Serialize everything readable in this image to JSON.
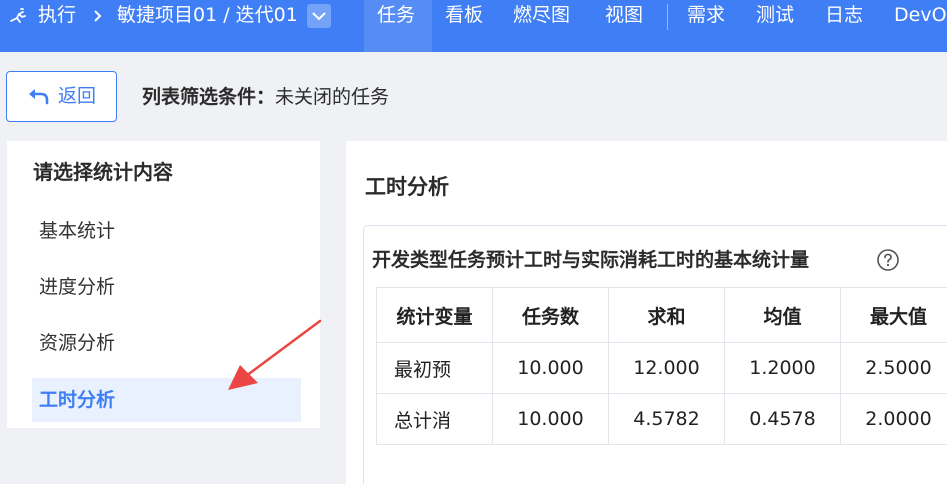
{
  "topbar": {
    "breadcrumb_root": "执行",
    "breadcrumb_path": "敏捷项目01 / 迭代01",
    "nav": [
      {
        "label": "任务",
        "active": true
      },
      {
        "label": "看板"
      },
      {
        "label": "燃尽图"
      },
      {
        "label": "视图"
      },
      {
        "label": "需求"
      },
      {
        "label": "测试"
      },
      {
        "label": "日志"
      },
      {
        "label": "DevO"
      }
    ]
  },
  "toolbar": {
    "back_label": "返回",
    "filter_label": "列表筛选条件：",
    "filter_value": "未关闭的任务"
  },
  "sidebar": {
    "title": "请选择统计内容",
    "items": [
      {
        "label": "基本统计"
      },
      {
        "label": "进度分析"
      },
      {
        "label": "资源分析"
      },
      {
        "label": "工时分析",
        "active": true
      }
    ]
  },
  "main": {
    "title": "工时分析",
    "card_title": "开发类型任务预计工时与实际消耗工时的基本统计量",
    "table": {
      "headers": [
        "统计变量",
        "任务数",
        "求和",
        "均值",
        "最大值"
      ],
      "rows": [
        [
          "最初预",
          "10.000",
          "12.000",
          "1.2000",
          "2.5000"
        ],
        [
          "总计消",
          "10.000",
          "4.5782",
          "0.4578",
          "2.0000"
        ]
      ]
    }
  },
  "colors": {
    "brand": "#3f7ef4",
    "active_bg": "#e8f1fd",
    "page_bg": "#eff1f4"
  }
}
